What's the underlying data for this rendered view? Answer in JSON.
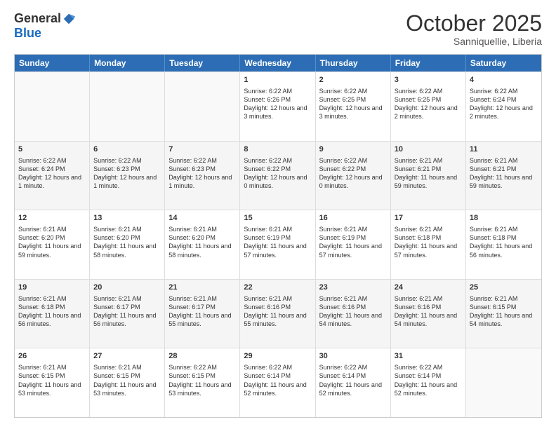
{
  "header": {
    "logo_general": "General",
    "logo_blue": "Blue",
    "month": "October 2025",
    "location": "Sanniquellie, Liberia"
  },
  "weekdays": [
    "Sunday",
    "Monday",
    "Tuesday",
    "Wednesday",
    "Thursday",
    "Friday",
    "Saturday"
  ],
  "weeks": [
    [
      {
        "day": "",
        "sunrise": "",
        "sunset": "",
        "daylight": "",
        "empty": true
      },
      {
        "day": "",
        "sunrise": "",
        "sunset": "",
        "daylight": "",
        "empty": true
      },
      {
        "day": "",
        "sunrise": "",
        "sunset": "",
        "daylight": "",
        "empty": true
      },
      {
        "day": "1",
        "sunrise": "Sunrise: 6:22 AM",
        "sunset": "Sunset: 6:26 PM",
        "daylight": "Daylight: 12 hours and 3 minutes.",
        "empty": false
      },
      {
        "day": "2",
        "sunrise": "Sunrise: 6:22 AM",
        "sunset": "Sunset: 6:25 PM",
        "daylight": "Daylight: 12 hours and 3 minutes.",
        "empty": false
      },
      {
        "day": "3",
        "sunrise": "Sunrise: 6:22 AM",
        "sunset": "Sunset: 6:25 PM",
        "daylight": "Daylight: 12 hours and 2 minutes.",
        "empty": false
      },
      {
        "day": "4",
        "sunrise": "Sunrise: 6:22 AM",
        "sunset": "Sunset: 6:24 PM",
        "daylight": "Daylight: 12 hours and 2 minutes.",
        "empty": false
      }
    ],
    [
      {
        "day": "5",
        "sunrise": "Sunrise: 6:22 AM",
        "sunset": "Sunset: 6:24 PM",
        "daylight": "Daylight: 12 hours and 1 minute.",
        "empty": false
      },
      {
        "day": "6",
        "sunrise": "Sunrise: 6:22 AM",
        "sunset": "Sunset: 6:23 PM",
        "daylight": "Daylight: 12 hours and 1 minute.",
        "empty": false
      },
      {
        "day": "7",
        "sunrise": "Sunrise: 6:22 AM",
        "sunset": "Sunset: 6:23 PM",
        "daylight": "Daylight: 12 hours and 1 minute.",
        "empty": false
      },
      {
        "day": "8",
        "sunrise": "Sunrise: 6:22 AM",
        "sunset": "Sunset: 6:22 PM",
        "daylight": "Daylight: 12 hours and 0 minutes.",
        "empty": false
      },
      {
        "day": "9",
        "sunrise": "Sunrise: 6:22 AM",
        "sunset": "Sunset: 6:22 PM",
        "daylight": "Daylight: 12 hours and 0 minutes.",
        "empty": false
      },
      {
        "day": "10",
        "sunrise": "Sunrise: 6:21 AM",
        "sunset": "Sunset: 6:21 PM",
        "daylight": "Daylight: 11 hours and 59 minutes.",
        "empty": false
      },
      {
        "day": "11",
        "sunrise": "Sunrise: 6:21 AM",
        "sunset": "Sunset: 6:21 PM",
        "daylight": "Daylight: 11 hours and 59 minutes.",
        "empty": false
      }
    ],
    [
      {
        "day": "12",
        "sunrise": "Sunrise: 6:21 AM",
        "sunset": "Sunset: 6:20 PM",
        "daylight": "Daylight: 11 hours and 59 minutes.",
        "empty": false
      },
      {
        "day": "13",
        "sunrise": "Sunrise: 6:21 AM",
        "sunset": "Sunset: 6:20 PM",
        "daylight": "Daylight: 11 hours and 58 minutes.",
        "empty": false
      },
      {
        "day": "14",
        "sunrise": "Sunrise: 6:21 AM",
        "sunset": "Sunset: 6:20 PM",
        "daylight": "Daylight: 11 hours and 58 minutes.",
        "empty": false
      },
      {
        "day": "15",
        "sunrise": "Sunrise: 6:21 AM",
        "sunset": "Sunset: 6:19 PM",
        "daylight": "Daylight: 11 hours and 57 minutes.",
        "empty": false
      },
      {
        "day": "16",
        "sunrise": "Sunrise: 6:21 AM",
        "sunset": "Sunset: 6:19 PM",
        "daylight": "Daylight: 11 hours and 57 minutes.",
        "empty": false
      },
      {
        "day": "17",
        "sunrise": "Sunrise: 6:21 AM",
        "sunset": "Sunset: 6:18 PM",
        "daylight": "Daylight: 11 hours and 57 minutes.",
        "empty": false
      },
      {
        "day": "18",
        "sunrise": "Sunrise: 6:21 AM",
        "sunset": "Sunset: 6:18 PM",
        "daylight": "Daylight: 11 hours and 56 minutes.",
        "empty": false
      }
    ],
    [
      {
        "day": "19",
        "sunrise": "Sunrise: 6:21 AM",
        "sunset": "Sunset: 6:18 PM",
        "daylight": "Daylight: 11 hours and 56 minutes.",
        "empty": false
      },
      {
        "day": "20",
        "sunrise": "Sunrise: 6:21 AM",
        "sunset": "Sunset: 6:17 PM",
        "daylight": "Daylight: 11 hours and 56 minutes.",
        "empty": false
      },
      {
        "day": "21",
        "sunrise": "Sunrise: 6:21 AM",
        "sunset": "Sunset: 6:17 PM",
        "daylight": "Daylight: 11 hours and 55 minutes.",
        "empty": false
      },
      {
        "day": "22",
        "sunrise": "Sunrise: 6:21 AM",
        "sunset": "Sunset: 6:16 PM",
        "daylight": "Daylight: 11 hours and 55 minutes.",
        "empty": false
      },
      {
        "day": "23",
        "sunrise": "Sunrise: 6:21 AM",
        "sunset": "Sunset: 6:16 PM",
        "daylight": "Daylight: 11 hours and 54 minutes.",
        "empty": false
      },
      {
        "day": "24",
        "sunrise": "Sunrise: 6:21 AM",
        "sunset": "Sunset: 6:16 PM",
        "daylight": "Daylight: 11 hours and 54 minutes.",
        "empty": false
      },
      {
        "day": "25",
        "sunrise": "Sunrise: 6:21 AM",
        "sunset": "Sunset: 6:15 PM",
        "daylight": "Daylight: 11 hours and 54 minutes.",
        "empty": false
      }
    ],
    [
      {
        "day": "26",
        "sunrise": "Sunrise: 6:21 AM",
        "sunset": "Sunset: 6:15 PM",
        "daylight": "Daylight: 11 hours and 53 minutes.",
        "empty": false
      },
      {
        "day": "27",
        "sunrise": "Sunrise: 6:21 AM",
        "sunset": "Sunset: 6:15 PM",
        "daylight": "Daylight: 11 hours and 53 minutes.",
        "empty": false
      },
      {
        "day": "28",
        "sunrise": "Sunrise: 6:22 AM",
        "sunset": "Sunset: 6:15 PM",
        "daylight": "Daylight: 11 hours and 53 minutes.",
        "empty": false
      },
      {
        "day": "29",
        "sunrise": "Sunrise: 6:22 AM",
        "sunset": "Sunset: 6:14 PM",
        "daylight": "Daylight: 11 hours and 52 minutes.",
        "empty": false
      },
      {
        "day": "30",
        "sunrise": "Sunrise: 6:22 AM",
        "sunset": "Sunset: 6:14 PM",
        "daylight": "Daylight: 11 hours and 52 minutes.",
        "empty": false
      },
      {
        "day": "31",
        "sunrise": "Sunrise: 6:22 AM",
        "sunset": "Sunset: 6:14 PM",
        "daylight": "Daylight: 11 hours and 52 minutes.",
        "empty": false
      },
      {
        "day": "",
        "sunrise": "",
        "sunset": "",
        "daylight": "",
        "empty": true
      }
    ]
  ]
}
